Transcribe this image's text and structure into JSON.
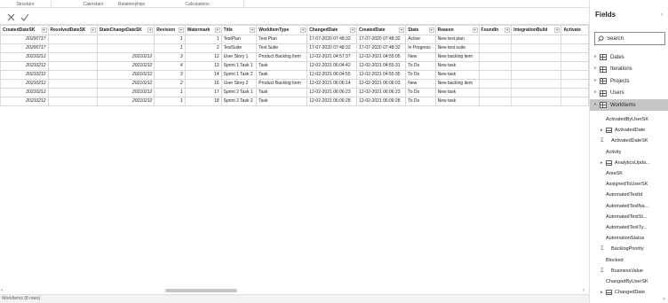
{
  "ribbon": {
    "groups": [
      "Structure",
      "Calendars",
      "Relationships",
      "Calculations"
    ]
  },
  "formula_bar": {
    "cancel_icon": "close-icon",
    "commit_icon": "check-icon"
  },
  "table": {
    "columns": [
      "CreatedDateSK",
      "ResolvedDateSK",
      "StateChangeDateSK",
      "Revision",
      "Watermark",
      "Title",
      "WorkItemType",
      "ChangedDate",
      "CreatedDate",
      "State",
      "Reason",
      "FoundIn",
      "IntegrationBuild",
      "Activate"
    ],
    "rows": [
      [
        "20200717",
        "",
        "",
        "1",
        "1",
        "TestPlan",
        "Test Plan",
        "17-07-2020 07:48:32",
        "17-07-2020 07:48:32",
        "Active",
        "New test plan",
        "",
        "",
        ""
      ],
      [
        "20200717",
        "",
        "",
        "1",
        "2",
        "TestSuite",
        "Test Suite",
        "17-07-2020 07:48:32",
        "17-07-2020 07:48:32",
        "In Progress",
        "New test suite",
        "",
        "",
        ""
      ],
      [
        "20210212",
        "",
        "20210212",
        "3",
        "12",
        "User Story 1",
        "Product Backlog Item",
        "12-02-2021 04:57:37",
        "12-02-2021 04:55:05",
        "New",
        "New backlog item",
        "",
        "",
        ""
      ],
      [
        "20210212",
        "",
        "20210212",
        "4",
        "13",
        "Sprint 1 Task 1",
        "Task",
        "12-02-2021 06:04:42",
        "12-02-2021 04:55:31",
        "To Do",
        "New task",
        "",
        "",
        ""
      ],
      [
        "20210212",
        "",
        "20210212",
        "3",
        "14",
        "Sprint 1 Task 2",
        "Task",
        "12-02-2021 06:04:55",
        "12-02-2021 04:55:35",
        "To Do",
        "New task",
        "",
        "",
        ""
      ],
      [
        "20210212",
        "",
        "20210212",
        "2",
        "16",
        "User Story 2",
        "Product Backlog Item",
        "12-02-2021 06:06:14",
        "12-02-2021 06:06:03",
        "New",
        "New backlog item",
        "",
        "",
        ""
      ],
      [
        "20210212",
        "",
        "20210212",
        "1",
        "17",
        "Sprint 2 Task 1",
        "Task",
        "12-02-2021 06:06:23",
        "12-02-2021 06:06:23",
        "To Do",
        "New task",
        "",
        "",
        ""
      ],
      [
        "20210212",
        "",
        "20210212",
        "1",
        "18",
        "Sprint 2 Task 2",
        "Task",
        "12-02-2021 06:06:28",
        "12-02-2021 06:06:28",
        "To Do",
        "New task",
        "",
        "",
        ""
      ]
    ]
  },
  "status_bar": {
    "text": "WorkItems (8 rows)"
  },
  "fields_pane": {
    "title": "Fields",
    "search_placeholder": "Search",
    "tables": [
      "Dates",
      "Iterations",
      "Projects",
      "Users",
      "WorkItems"
    ],
    "active_table": "WorkItems",
    "fields": [
      {
        "label": "ActivatedByUserSK",
        "kind": "plain"
      },
      {
        "label": "ActivatedDate",
        "kind": "hierarchy"
      },
      {
        "label": "ActivatedDateSK",
        "kind": "sum"
      },
      {
        "label": "Activity",
        "kind": "plain"
      },
      {
        "label": "AnalyticsUpda...",
        "kind": "hierarchy"
      },
      {
        "label": "AreaSK",
        "kind": "plain"
      },
      {
        "label": "AssignedToUserSK",
        "kind": "plain"
      },
      {
        "label": "AutomatedTestId",
        "kind": "plain"
      },
      {
        "label": "AutomatedTestNa...",
        "kind": "plain"
      },
      {
        "label": "AutomatedTestSt...",
        "kind": "plain"
      },
      {
        "label": "AutomatedTestTy...",
        "kind": "plain"
      },
      {
        "label": "AutomationStatus",
        "kind": "plain"
      },
      {
        "label": "BacklogPriority",
        "kind": "sum"
      },
      {
        "label": "Blocked",
        "kind": "plain"
      },
      {
        "label": "BusinessValue",
        "kind": "sum"
      },
      {
        "label": "ChangedByUserSK",
        "kind": "plain"
      },
      {
        "label": "ChangedDate",
        "kind": "hierarchy"
      }
    ]
  },
  "colors": {
    "active_table_bg": "#c8c6c4",
    "border": "#d9d9d9",
    "text": "#252423"
  }
}
